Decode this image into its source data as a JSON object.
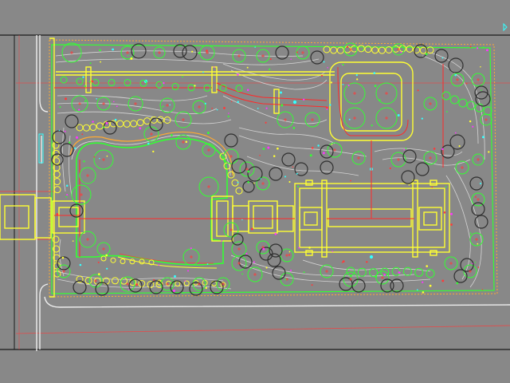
{
  "colors": {
    "background": "#888888",
    "frame": "#1a1a1a",
    "plant": "#33ff33",
    "tree_dark": "#333333",
    "structure": "#ffff33",
    "axis": "#ff2a2a",
    "planting_line": "#dcdcdc",
    "white_line": "#eeeeee",
    "label": "#ffdd55",
    "magenta": "#ff33ff",
    "cyan": "#33ffff"
  }
}
